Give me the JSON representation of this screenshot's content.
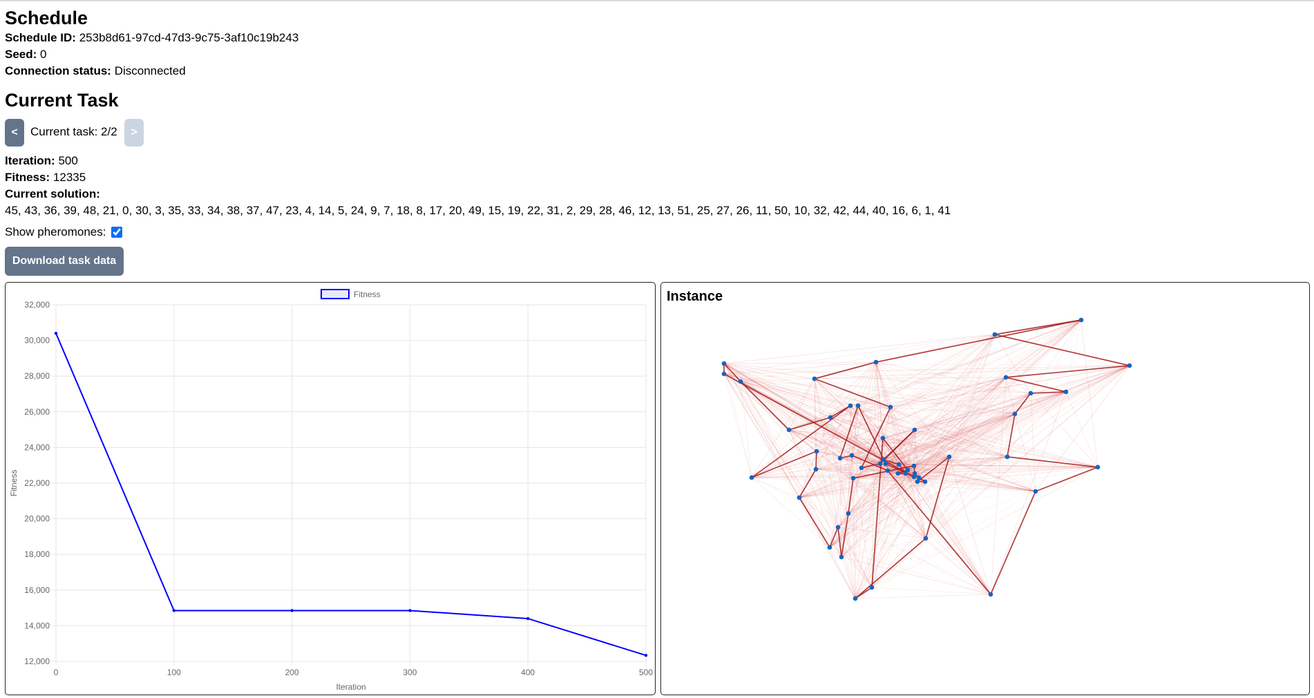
{
  "schedule": {
    "title": "Schedule",
    "id_label": "Schedule ID:",
    "id_value": "253b8d61-97cd-47d3-9c75-3af10c19b243",
    "seed_label": "Seed:",
    "seed_value": "0",
    "status_label": "Connection status:",
    "status_value": "Disconnected"
  },
  "task": {
    "title": "Current Task",
    "prev_label": "<",
    "next_label": ">",
    "counter": "Current task: 2/2",
    "iteration_label": "Iteration:",
    "iteration_value": "500",
    "fitness_label": "Fitness:",
    "fitness_value": "12335",
    "solution_label": "Current solution:",
    "solution_value": "45, 43, 36, 39, 48, 21, 0, 30, 3, 35, 33, 34, 38, 37, 47, 23, 4, 14, 5, 24, 9, 7, 18, 8, 17, 20, 49, 15, 19, 22, 31, 2, 29, 28, 46, 12, 13, 51, 25, 27, 26, 11, 50, 10, 32, 42, 44, 40, 16, 6, 1, 41",
    "pheromones_label": "Show pheromones:",
    "pheromones_checked": true,
    "download_label": "Download task data"
  },
  "instance": {
    "title": "Instance"
  },
  "colors": {
    "line": "#0000ff",
    "node": "#1565c0",
    "edge": "#cc0000",
    "button": "#64748b",
    "button_disabled": "#cbd5e1"
  },
  "chart_data": {
    "type": "line",
    "legend": [
      "Fitness"
    ],
    "legend_position": "top",
    "xlabel": "Iteration",
    "ylabel": "Fitness",
    "xlim": [
      0,
      500
    ],
    "ylim": [
      12000,
      32000
    ],
    "x_ticks": [
      "0",
      "100",
      "200",
      "300",
      "400",
      "500"
    ],
    "y_ticks": [
      "12,000",
      "14,000",
      "16,000",
      "18,000",
      "20,000",
      "22,000",
      "24,000",
      "26,000",
      "28,000",
      "30,000",
      "32,000"
    ],
    "grid": true,
    "series": [
      {
        "name": "Fitness",
        "x": [
          0,
          100,
          200,
          300,
          400,
          500
        ],
        "y": [
          30400,
          14850,
          14850,
          14850,
          14400,
          12335
        ]
      }
    ]
  }
}
